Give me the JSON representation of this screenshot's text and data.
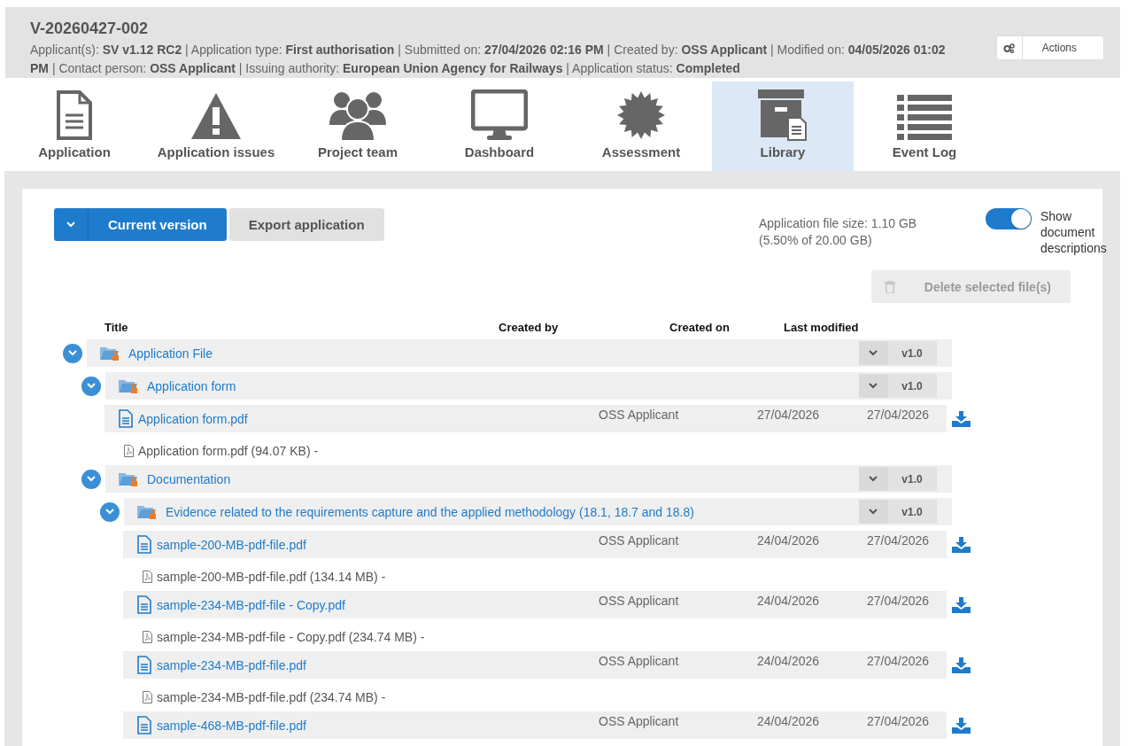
{
  "header": {
    "title": "V-20260427-002",
    "meta": "Applicant(s): **SV v1.12 RC2** | Application type: **First authorisation** | Submitted on: **27/04/2026 02:16 PM** | Created by: **OSS Applicant** | Modified on: **04/05/2026 01:02 PM** | Contact person: **OSS Applicant** | Issuing authority: **European Union Agency for Railways** | Application status: **Completed**",
    "actions_label": "Actions"
  },
  "tabs": [
    {
      "label": "Application",
      "selected": false
    },
    {
      "label": "Application issues",
      "selected": false
    },
    {
      "label": "Project team",
      "selected": false
    },
    {
      "label": "Dashboard",
      "selected": false
    },
    {
      "label": "Assessment",
      "selected": false
    },
    {
      "label": "Library",
      "selected": true
    },
    {
      "label": "Event Log",
      "selected": false
    }
  ],
  "toolbar": {
    "version_button": "Current version",
    "export_button": "Export application",
    "file_size": "Application file size: 1.10 GB",
    "file_share": "(5.50% of 20.00 GB)",
    "show_descriptions": {
      "label": "Show document descriptions",
      "on": true
    },
    "delete_button": {
      "label": "Delete selected file(s)",
      "disabled": true
    }
  },
  "table": {
    "columns": [
      "Title",
      "Created by",
      "Created on",
      "Last modified"
    ],
    "tree": [
      {
        "kind": "folder",
        "title": "Application File",
        "version": "v1.0",
        "expanded": true,
        "children": [
          {
            "kind": "folder",
            "title": "Application form",
            "version": "v1.0",
            "expanded": true,
            "children": [
              {
                "kind": "file",
                "title": "Application form.pdf",
                "created_by": "OSS Applicant",
                "created_on": "27/04/2026",
                "last_modified": "27/04/2026",
                "description": "Application form.pdf (94.07 KB) -"
              }
            ]
          },
          {
            "kind": "folder",
            "title": "Documentation",
            "version": "v1.0",
            "expanded": true,
            "children": [
              {
                "kind": "folder",
                "title": "Evidence related to the requirements capture and the applied methodology (18.1, 18.7 and 18.8)",
                "version": "v1.0",
                "expanded": true,
                "children": [
                  {
                    "kind": "file",
                    "title": "sample-200-MB-pdf-file.pdf",
                    "created_by": "OSS Applicant",
                    "created_on": "24/04/2026",
                    "last_modified": "27/04/2026",
                    "description": "sample-200-MB-pdf-file.pdf (134.14 MB) -"
                  },
                  {
                    "kind": "file",
                    "title": "sample-234-MB-pdf-file - Copy.pdf",
                    "created_by": "OSS Applicant",
                    "created_on": "24/04/2026",
                    "last_modified": "27/04/2026",
                    "description": "sample-234-MB-pdf-file - Copy.pdf (234.74 MB) -"
                  },
                  {
                    "kind": "file",
                    "title": "sample-234-MB-pdf-file.pdf",
                    "created_by": "OSS Applicant",
                    "created_on": "24/04/2026",
                    "last_modified": "27/04/2026",
                    "description": "sample-234-MB-pdf-file.pdf (234.74 MB) -"
                  },
                  {
                    "kind": "file",
                    "title": "sample-468-MB-pdf-file.pdf",
                    "created_by": "OSS Applicant",
                    "created_on": "24/04/2026",
                    "last_modified": "27/04/2026"
                  }
                ]
              }
            ]
          }
        ]
      }
    ]
  }
}
